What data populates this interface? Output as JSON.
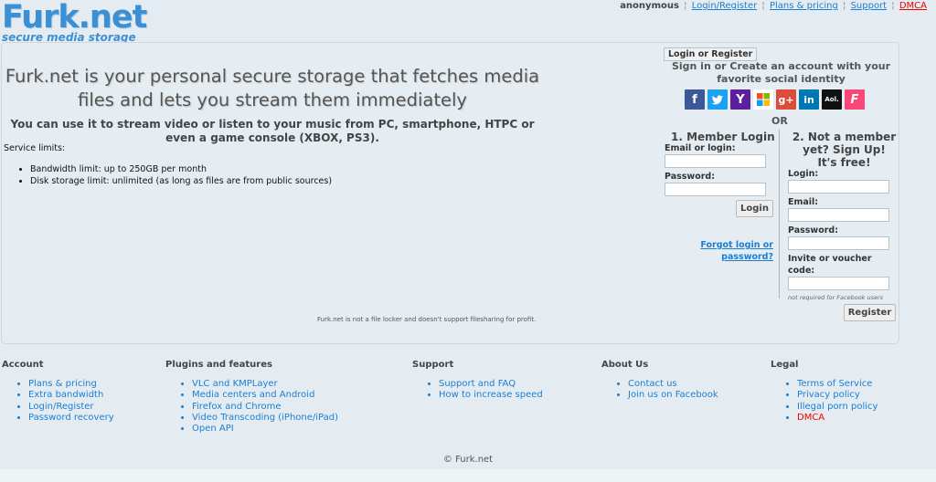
{
  "logo": {
    "main": "Furk.net",
    "sub": "secure media storage"
  },
  "topnav": {
    "user": "anonymous",
    "separator": "¦",
    "links": [
      "Login/Register",
      "Plans & pricing",
      "Support",
      "DMCA"
    ]
  },
  "main": {
    "headline": "Furk.net is your personal secure storage that fetches media files and lets you stream them immediately",
    "subline": "You can use it to stream video or listen to your music from PC, smartphone, HTPC or even a game console (XBOX, PS3).",
    "limits_title": "Service limits:",
    "limits": [
      "Bandwidth limit: up to 250GB per month",
      "Disk storage limit: unlimited (as long as files are from public sources)"
    ],
    "footnote": "Furk.net is not a file locker and doesn't support filesharing for profit."
  },
  "login": {
    "tab": "Login or Register",
    "signin_text": "Sign in or Create an account with your favorite social identity",
    "social": [
      {
        "icon": "facebook-icon",
        "glyph": "f",
        "color": "#3b5998"
      },
      {
        "icon": "twitter-icon",
        "glyph": "t",
        "color": "#1da1f2"
      },
      {
        "icon": "yahoo-icon",
        "glyph": "Y",
        "color": "#5c1f9d"
      },
      {
        "icon": "microsoft-icon",
        "glyph": "",
        "color": "#ffffff"
      },
      {
        "icon": "google-plus-icon",
        "glyph": "g+",
        "color": "#dd4b39"
      },
      {
        "icon": "linkedin-icon",
        "glyph": "in",
        "color": "#0077b5"
      },
      {
        "icon": "aol-icon",
        "glyph": "Aol.",
        "color": "#111111"
      },
      {
        "icon": "foursquare-icon",
        "glyph": "F",
        "color": "#f94877"
      }
    ],
    "or": "OR",
    "member_title": "1. Member Login",
    "email_label": "Email or login:",
    "password_label": "Password:",
    "login_button": "Login",
    "forgot": "Forgot login or password?",
    "notmember_title": "2. Not a member yet? Sign Up! It's free!",
    "reg_login_label": "Login:",
    "reg_email_label": "Email:",
    "reg_password_label": "Password:",
    "reg_voucher_label": "Invite or voucher code:",
    "reg_note": "not required for Facebook users",
    "register_button": "Register"
  },
  "footer": {
    "columns": [
      {
        "title": "Account",
        "items": [
          "Plans & pricing",
          "Extra bandwidth",
          "Login/Register",
          "Password recovery"
        ]
      },
      {
        "title": "Plugins and features",
        "items": [
          "VLC and KMPLayer",
          "Media centers and Android",
          "Firefox and Chrome",
          "Video Transcoding (iPhone/iPad)",
          "Open API"
        ]
      },
      {
        "title": "Support",
        "items": [
          "Support and FAQ",
          "How to increase speed"
        ]
      },
      {
        "title": "About Us",
        "items": [
          "Contact us",
          "Join us on Facebook"
        ]
      },
      {
        "title": "Legal",
        "items": [
          "Terms of Service",
          "Privacy policy",
          "Illegal porn policy",
          "DMCA"
        ]
      }
    ],
    "copyright": "© Furk.net"
  },
  "colors": {
    "link": "#1a7fd4",
    "alert": "#ee0000",
    "brand": "#3d8fd4"
  }
}
